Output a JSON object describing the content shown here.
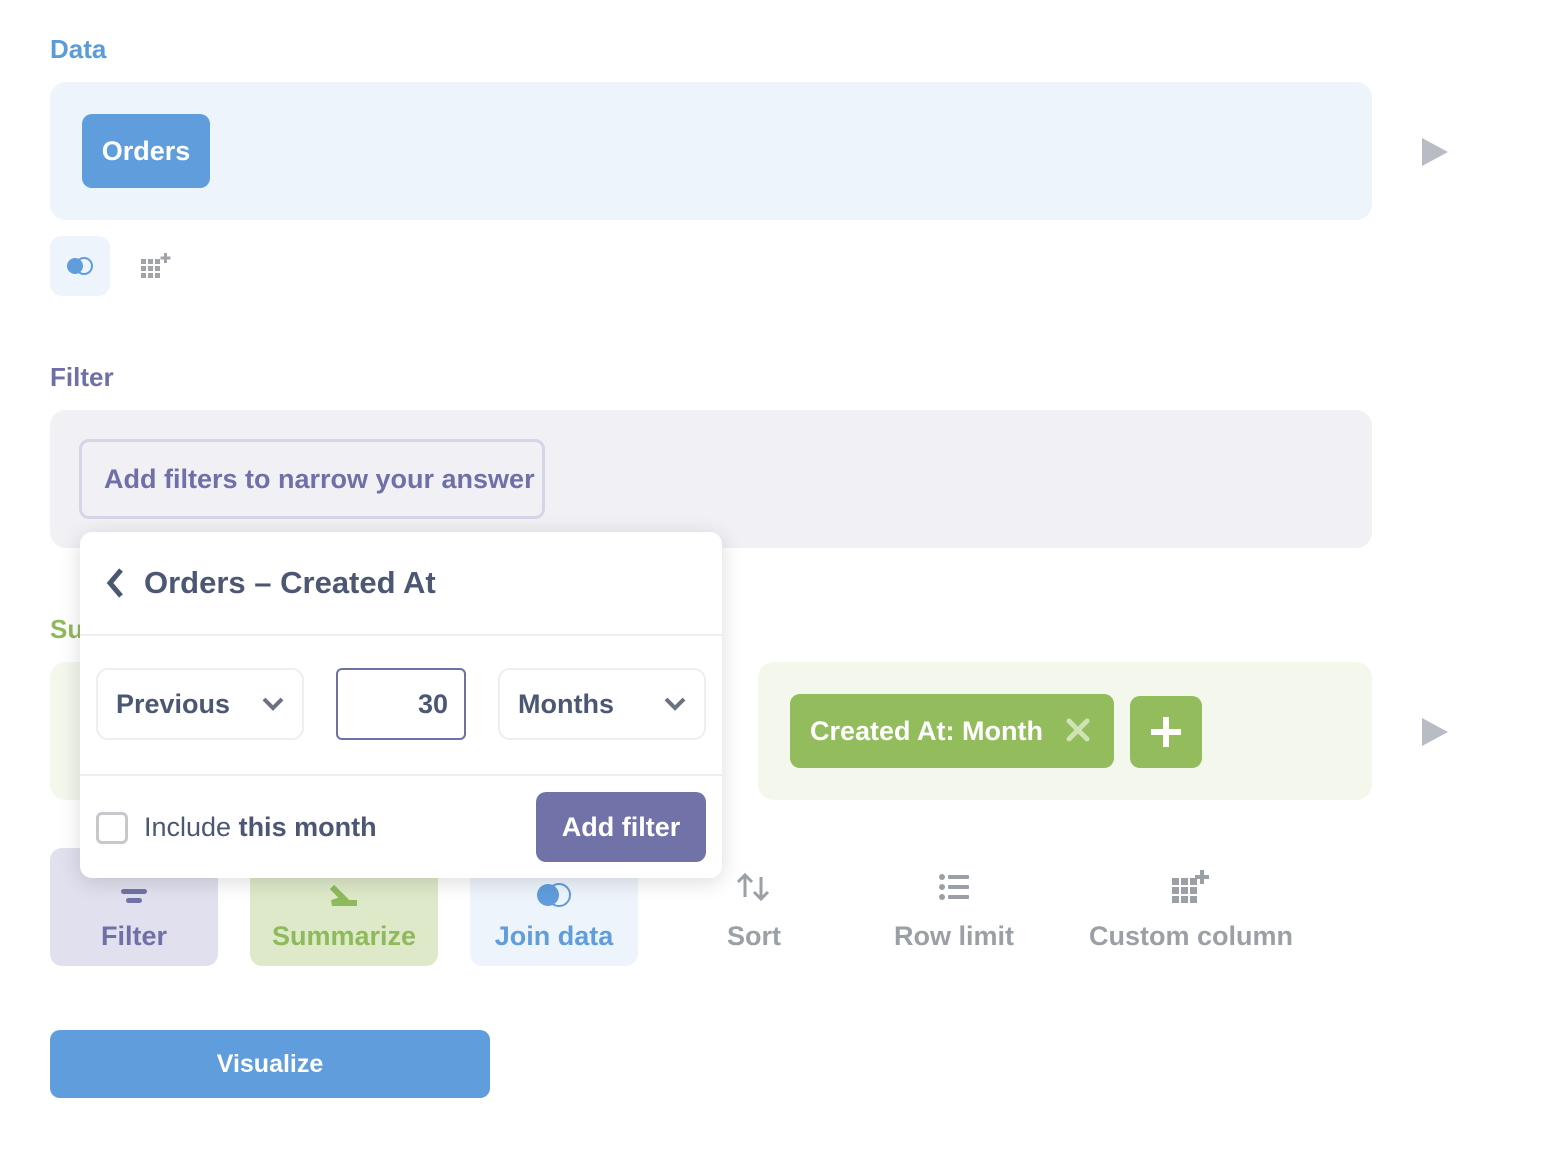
{
  "data_section": {
    "label": "Data",
    "source_table": "Orders",
    "join_icon": "join-venn-icon",
    "custom_column_icon": "grid-plus-icon",
    "run_icon": "play-icon"
  },
  "filter_section": {
    "label": "Filter",
    "placeholder": "Add filters to narrow your answer"
  },
  "summarize_section": {
    "label_visible": "Su",
    "group_by": [
      {
        "label": "Created At: Month",
        "remove_icon": "close-icon"
      }
    ],
    "add_icon": "plus-icon",
    "run_icon": "play-icon"
  },
  "filter_popover": {
    "title": "Orders – Created At",
    "back_icon": "chevron-left-icon",
    "period": {
      "selected": "Previous"
    },
    "amount": "30",
    "unit": {
      "selected": "Months"
    },
    "include_label_prefix": "Include ",
    "include_label_bold": "this month",
    "include_checked": false,
    "submit_label": "Add filter"
  },
  "actions": [
    {
      "label": "Filter",
      "icon": "filter-icon"
    },
    {
      "label": "Summarize",
      "icon": "sigma-icon"
    },
    {
      "label": "Join data",
      "icon": "join-venn-icon"
    },
    {
      "label": "Sort",
      "icon": "sort-arrows-icon"
    },
    {
      "label": "Row limit",
      "icon": "list-icon"
    },
    {
      "label": "Custom column",
      "icon": "grid-plus-icon"
    }
  ],
  "visualize_label": "Visualize",
  "colors": {
    "data_accent": "#5f9ddc",
    "filter_accent": "#7173a8",
    "summarize_accent": "#93bc5d",
    "text_dark": "#4c5773",
    "muted": "#9aa0a6"
  }
}
